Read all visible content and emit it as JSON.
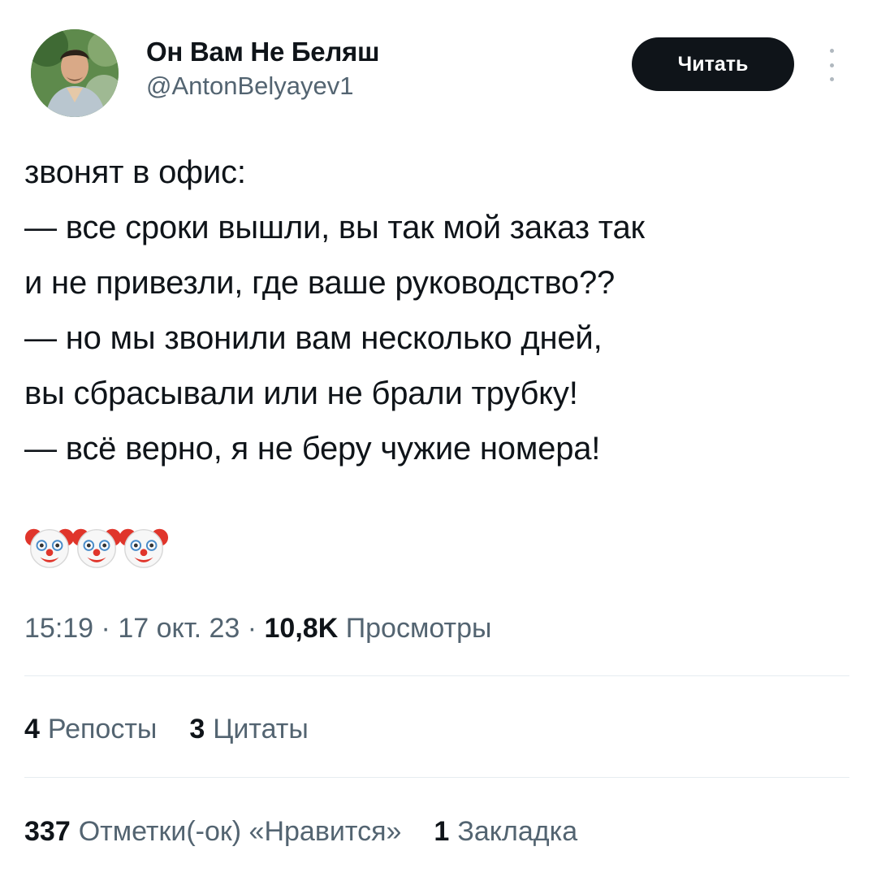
{
  "author": {
    "display_name": "Он Вам Не Беляш",
    "handle": "@AntonBelyayev1"
  },
  "follow_button_label": "Читать",
  "more_icon": "vertical-ellipsis-icon",
  "tweet": {
    "text": "звонят в офис:\n— все сроки вышли, вы так мой заказ так\nи не привезли, где ваше руководство??\n— но мы звонили вам несколько дней,\nвы сбрасывали или не брали трубку!\n— всё верно, я не беру чужие номера!",
    "emoji": [
      "clown-face-icon",
      "clown-face-icon",
      "clown-face-icon"
    ]
  },
  "meta": {
    "time": "15:19",
    "separator": "·",
    "date": "17 окт. 23",
    "views_count": "10,8K",
    "views_label": "Просмотры"
  },
  "stats": {
    "reposts": {
      "count": "4",
      "label": "Репосты"
    },
    "quotes": {
      "count": "3",
      "label": "Цитаты"
    },
    "likes": {
      "count": "337",
      "label": "Отметки(-ок) «Нравится»"
    },
    "bookmarks": {
      "count": "1",
      "label": "Закладка"
    }
  },
  "colors": {
    "text_primary": "#0f1419",
    "text_secondary": "#536471",
    "divider": "#e6ecf0",
    "button_bg": "#0f1419"
  }
}
